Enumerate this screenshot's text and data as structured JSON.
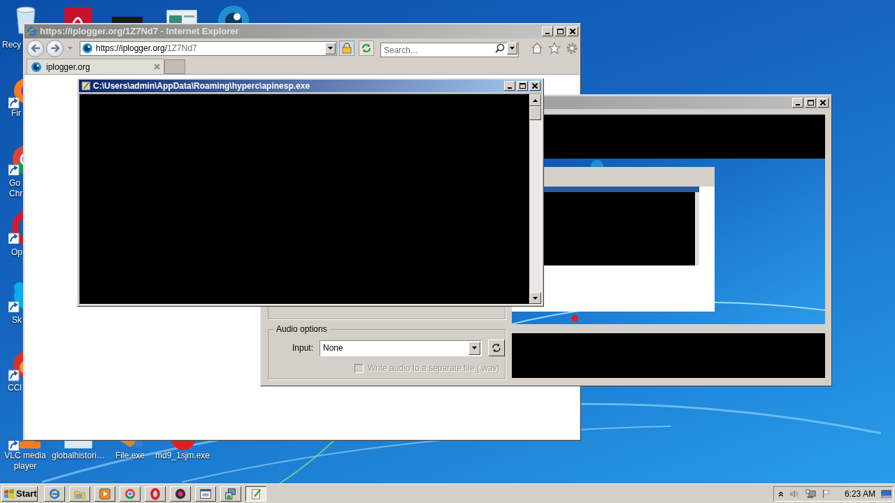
{
  "desktop_icons": [
    {
      "kind": "recycle-bin",
      "label_lines": [
        "Recy"
      ]
    },
    {
      "kind": "acrobat"
    },
    {
      "kind": "media-tile"
    },
    {
      "kind": "app-window"
    },
    {
      "kind": "eye-app"
    },
    {
      "kind": "firefox",
      "label_lines": [
        "Fir"
      ]
    },
    {
      "kind": "chrome",
      "label_lines": [
        "Go",
        "Chr"
      ]
    },
    {
      "kind": "opera",
      "label_lines": [
        "Op"
      ]
    },
    {
      "kind": "skype",
      "label_lines": [
        "Sk"
      ]
    },
    {
      "kind": "ccleaner",
      "label_lines": [
        "CCl"
      ]
    },
    {
      "kind": "vlc",
      "label_lines": [
        "VLC media",
        "player"
      ]
    },
    {
      "kind": "file",
      "label_lines": [
        "globalhistori…"
      ]
    },
    {
      "kind": "archive",
      "label_lines": [
        "File.exe"
      ]
    },
    {
      "kind": "red-app",
      "label_lines": [
        "md9_1sjm.exe"
      ]
    }
  ],
  "browser": {
    "title": "https://iplogger.org/1Z7Nd7 - Internet Explorer",
    "address": {
      "host": "https://iplogger.org/",
      "path": "1Z7Nd7"
    },
    "search": {
      "placeholder": "Search..."
    },
    "tabs": [
      {
        "label": "iplogger.org",
        "selected": true
      }
    ]
  },
  "console": {
    "title": "C:\\Users\\admin\\AppData\\Roaming\\hyperc\\apinesp.exe"
  },
  "recorder": {
    "audio_options": {
      "title": "Audio options",
      "input_label": "Input:",
      "input_value": "None",
      "separate_file": {
        "label": "Write audio to a separate file (.wav)",
        "checked": false,
        "disabled": true
      }
    }
  },
  "taskbar": {
    "start_label": "Start",
    "buttons": [
      {
        "kind": "ie",
        "selected": false
      },
      {
        "kind": "folder",
        "selected": false
      },
      {
        "kind": "media",
        "selected": false
      },
      {
        "kind": "chrome",
        "selected": false
      },
      {
        "kind": "opera",
        "selected": false
      },
      {
        "kind": "recorder",
        "selected": false
      },
      {
        "kind": "window",
        "selected": false
      },
      {
        "kind": "installer",
        "selected": false
      },
      {
        "kind": "editor",
        "selected": true
      }
    ],
    "clock": "6:23 AM"
  }
}
